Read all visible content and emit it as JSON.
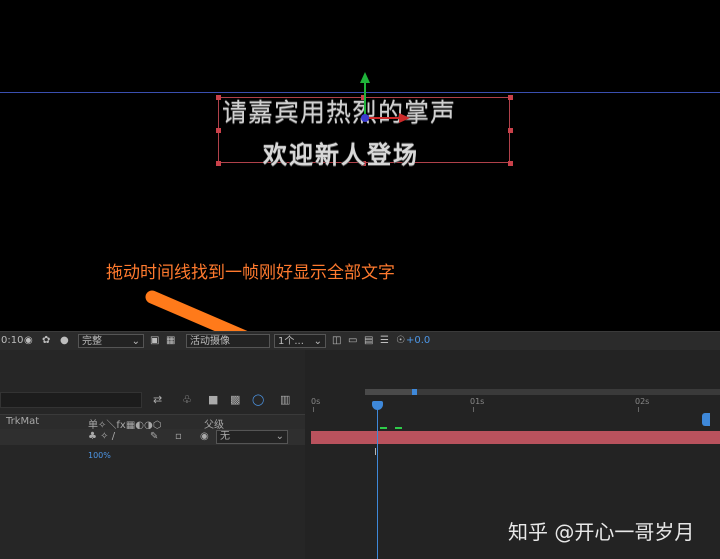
{
  "composition": {
    "text_line_1": "请嘉宾用热烈的掌声",
    "text_line_2": "欢迎新人登场"
  },
  "annotation": {
    "instruction": "拖动时间线找到一帧刚好显示全部文字"
  },
  "toolbar": {
    "time_value": "0:10",
    "resolution": "完整",
    "camera": "活动摄像",
    "view": "1个...",
    "exposure": "+0.0"
  },
  "timeline": {
    "col_trkmat": "TrkMat",
    "col_switches": "单✧＼fx▦◐◑⬡",
    "col_parent": "父级",
    "parent_value": "无",
    "scale_value": "100%",
    "ruler_labels": [
      "0s",
      "01s",
      "02s"
    ]
  },
  "watermark": "知乎 @开心一哥岁月",
  "colors": {
    "accent_blue": "#3e88d9",
    "clip_color": "#b9525d",
    "annotation_orange": "#ff7a2e"
  }
}
